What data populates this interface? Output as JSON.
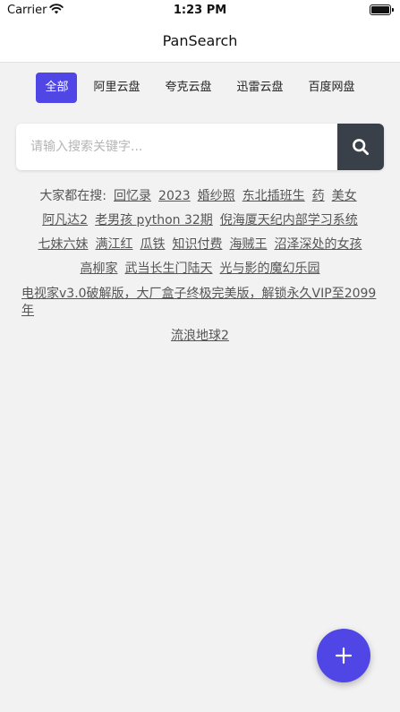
{
  "status_bar": {
    "carrier": "Carrier",
    "time": "1:23 PM"
  },
  "navbar": {
    "title": "PanSearch"
  },
  "tabs": [
    {
      "label": "全部",
      "active": true
    },
    {
      "label": "阿里云盘",
      "active": false
    },
    {
      "label": "夸克云盘",
      "active": false
    },
    {
      "label": "迅雷云盘",
      "active": false
    },
    {
      "label": "百度网盘",
      "active": false
    }
  ],
  "search": {
    "placeholder": "请输入搜索关键字...",
    "value": ""
  },
  "hot_keywords": {
    "prefix": "大家都在搜:",
    "items": [
      "回忆录",
      "2023",
      "婚纱照",
      "东北插班生",
      "药",
      "美女",
      "阿凡达2",
      "老男孩 python 32期",
      "倪海厦天纪内部学习系统",
      "七妹六妹",
      "满江红",
      "瓜铁",
      "知识付费",
      "海贼王",
      "沼泽深处的女孩",
      "高柳家",
      "武当长生门陆天",
      "光与影的魔幻乐园",
      "电视家v3.0破解版，大厂盒子终极完美版，解锁永久VIP至2099年",
      "流浪地球2"
    ]
  },
  "colors": {
    "accent": "#4f46e5",
    "search_button": "#3a4049",
    "background": "#f2f2f2"
  },
  "icons": {
    "search_button": "search-icon",
    "fab": "plus-icon"
  }
}
